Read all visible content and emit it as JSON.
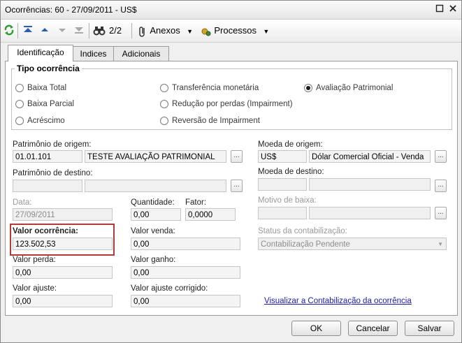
{
  "window": {
    "title": "Ocorrências: 60 - 27/09/2011 - US$"
  },
  "toolbar": {
    "record_counter": "2/2",
    "anexos_label": "Anexos",
    "processos_label": "Processos"
  },
  "tabs": [
    {
      "label": "Identificação"
    },
    {
      "label": "Indices"
    },
    {
      "label": "Adicionais"
    }
  ],
  "tipo": {
    "title": "Tipo ocorrência",
    "options": [
      {
        "label": "Baixa Total",
        "selected": false
      },
      {
        "label": "Baixa Parcial",
        "selected": false
      },
      {
        "label": "Acréscimo",
        "selected": false
      },
      {
        "label": "Transferência monetária",
        "selected": false
      },
      {
        "label": "Redução por perdas (Impairment)",
        "selected": false
      },
      {
        "label": "Reversão de Impairment",
        "selected": false
      },
      {
        "label": "Avaliação Patrimonial",
        "selected": true
      }
    ]
  },
  "form": {
    "patrimonio_origem_label": "Patrimônio de origem:",
    "patrimonio_origem_code": "01.01.101",
    "patrimonio_origem_desc": "TESTE AVALIAÇÃO PATRIMONIAL",
    "patrimonio_destino_label": "Patrimônio de destino:",
    "moeda_origem_label": "Moeda de origem:",
    "moeda_origem_code": "US$",
    "moeda_origem_desc": "Dólar Comercial Oficial - Venda",
    "moeda_destino_label": "Moeda de destino:",
    "data_label": "Data:",
    "data_value": "27/09/2011",
    "quantidade_label": "Quantidade:",
    "quantidade_value": "0,00",
    "fator_label": "Fator:",
    "fator_value": "0,0000",
    "motivo_baixa_label": "Motivo de baixa:",
    "valor_ocorrencia_label": "Valor ocorrência:",
    "valor_ocorrencia_value": "123.502,53",
    "valor_venda_label": "Valor venda:",
    "valor_venda_value": "0,00",
    "status_label": "Status da contabilização:",
    "status_value": "Contabilização Pendente",
    "valor_perda_label": "Valor perda:",
    "valor_perda_value": "0,00",
    "valor_ganho_label": "Valor ganho:",
    "valor_ganho_value": "0,00",
    "valor_ajuste_label": "Valor ajuste:",
    "valor_ajuste_value": "0,00",
    "valor_ajuste_corrigido_label": "Valor ajuste corrigido:",
    "valor_ajuste_corrigido_value": "0,00",
    "link_text": "Visualizar a Contabilização da ocorrência",
    "ellipsis": "..."
  },
  "buttons": {
    "ok": "OK",
    "cancel": "Cancelar",
    "save": "Salvar"
  },
  "colors": {
    "highlight": "#b03a3a",
    "link": "#1a1aa6",
    "accent_blue": "#2a5db0",
    "refresh_green": "#2e9a2e"
  }
}
